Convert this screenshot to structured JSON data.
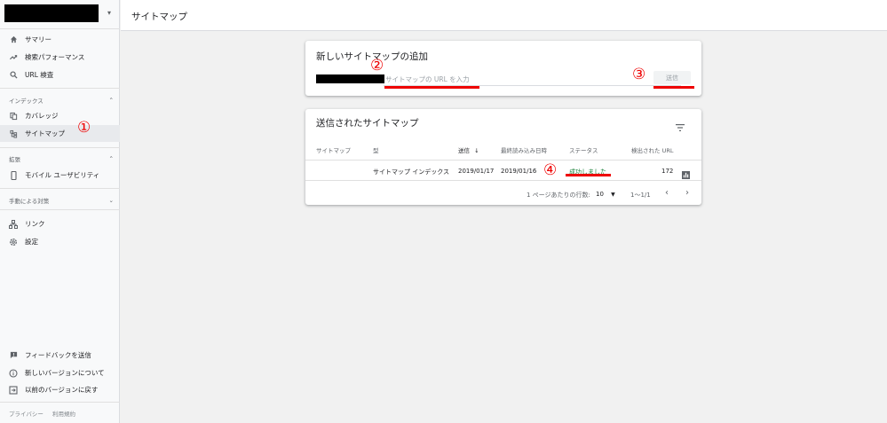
{
  "sidebar": {
    "property_caret": "▾",
    "items_top": [
      {
        "label": "サマリー",
        "icon": "home-icon"
      },
      {
        "label": "検索パフォーマンス",
        "icon": "trending-up-icon"
      },
      {
        "label": "URL 検査",
        "icon": "search-icon"
      }
    ],
    "section_index": {
      "label": "インデックス",
      "chevron": "⌃"
    },
    "items_index": [
      {
        "label": "カバレッジ",
        "icon": "copy-icon"
      },
      {
        "label": "サイトマップ",
        "icon": "sitemap-icon"
      }
    ],
    "section_enhance": {
      "label": "拡張",
      "chevron": "⌃"
    },
    "items_enhance": [
      {
        "label": "モバイル ユーザビリティ",
        "icon": "phone-icon"
      }
    ],
    "section_manual": {
      "label": "手動による対策",
      "chevron": "⌄"
    },
    "items_bottom": [
      {
        "label": "リンク",
        "icon": "links-icon"
      },
      {
        "label": "設定",
        "icon": "gear-icon"
      }
    ],
    "items_feedback": [
      {
        "label": "フィードバックを送信",
        "icon": "feedback-icon"
      },
      {
        "label": "新しいバージョンについて",
        "icon": "info-icon"
      },
      {
        "label": "以前のバージョンに戻す",
        "icon": "exit-icon"
      }
    ],
    "footer": {
      "privacy": "プライバシー",
      "terms": "利用規約"
    }
  },
  "header": {
    "title": "サイトマップ"
  },
  "add_card": {
    "title": "新しいサイトマップの追加",
    "input_placeholder": "サイトマップの URL を入力",
    "submit_label": "送信"
  },
  "submitted_card": {
    "title": "送信されたサイトマップ",
    "columns": [
      "サイトマップ",
      "型",
      "送信",
      "最終読み込み日時",
      "ステータス",
      "検出された URL"
    ],
    "sort_arrow": "↓",
    "rows": [
      {
        "sitemap": "",
        "type": "サイトマップ インデックス",
        "submitted": "2019/01/17",
        "last_read": "2019/01/16",
        "status": "成功しました",
        "discovered": "172"
      }
    ],
    "pager": {
      "rows_per_page_label": "1 ページあたりの行数:",
      "rows_per_page": "10",
      "range": "1〜1/1",
      "prev": "‹",
      "next": "›"
    }
  },
  "annotations": {
    "n1": "①",
    "n2": "②",
    "n3": "③",
    "n4": "④"
  },
  "colors": {
    "annotation": "#ee0000",
    "success": "#188038",
    "active_bg": "#e8eaed"
  }
}
